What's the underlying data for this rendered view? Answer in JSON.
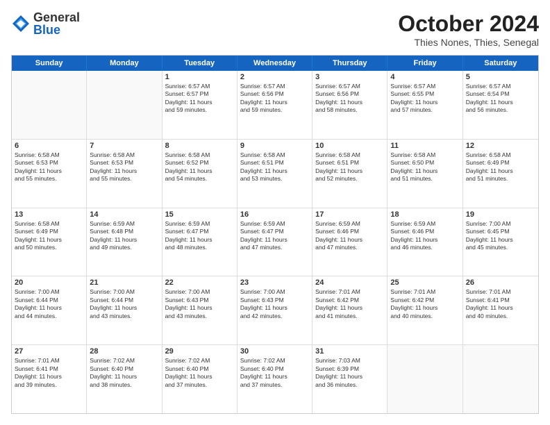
{
  "header": {
    "logo": {
      "general": "General",
      "blue": "Blue"
    },
    "title": "October 2024",
    "subtitle": "Thies Nones, Thies, Senegal"
  },
  "weekdays": [
    "Sunday",
    "Monday",
    "Tuesday",
    "Wednesday",
    "Thursday",
    "Friday",
    "Saturday"
  ],
  "weeks": [
    [
      {
        "day": "",
        "lines": []
      },
      {
        "day": "",
        "lines": []
      },
      {
        "day": "1",
        "lines": [
          "Sunrise: 6:57 AM",
          "Sunset: 6:57 PM",
          "Daylight: 11 hours",
          "and 59 minutes."
        ]
      },
      {
        "day": "2",
        "lines": [
          "Sunrise: 6:57 AM",
          "Sunset: 6:56 PM",
          "Daylight: 11 hours",
          "and 59 minutes."
        ]
      },
      {
        "day": "3",
        "lines": [
          "Sunrise: 6:57 AM",
          "Sunset: 6:56 PM",
          "Daylight: 11 hours",
          "and 58 minutes."
        ]
      },
      {
        "day": "4",
        "lines": [
          "Sunrise: 6:57 AM",
          "Sunset: 6:55 PM",
          "Daylight: 11 hours",
          "and 57 minutes."
        ]
      },
      {
        "day": "5",
        "lines": [
          "Sunrise: 6:57 AM",
          "Sunset: 6:54 PM",
          "Daylight: 11 hours",
          "and 56 minutes."
        ]
      }
    ],
    [
      {
        "day": "6",
        "lines": [
          "Sunrise: 6:58 AM",
          "Sunset: 6:53 PM",
          "Daylight: 11 hours",
          "and 55 minutes."
        ]
      },
      {
        "day": "7",
        "lines": [
          "Sunrise: 6:58 AM",
          "Sunset: 6:53 PM",
          "Daylight: 11 hours",
          "and 55 minutes."
        ]
      },
      {
        "day": "8",
        "lines": [
          "Sunrise: 6:58 AM",
          "Sunset: 6:52 PM",
          "Daylight: 11 hours",
          "and 54 minutes."
        ]
      },
      {
        "day": "9",
        "lines": [
          "Sunrise: 6:58 AM",
          "Sunset: 6:51 PM",
          "Daylight: 11 hours",
          "and 53 minutes."
        ]
      },
      {
        "day": "10",
        "lines": [
          "Sunrise: 6:58 AM",
          "Sunset: 6:51 PM",
          "Daylight: 11 hours",
          "and 52 minutes."
        ]
      },
      {
        "day": "11",
        "lines": [
          "Sunrise: 6:58 AM",
          "Sunset: 6:50 PM",
          "Daylight: 11 hours",
          "and 51 minutes."
        ]
      },
      {
        "day": "12",
        "lines": [
          "Sunrise: 6:58 AM",
          "Sunset: 6:49 PM",
          "Daylight: 11 hours",
          "and 51 minutes."
        ]
      }
    ],
    [
      {
        "day": "13",
        "lines": [
          "Sunrise: 6:58 AM",
          "Sunset: 6:49 PM",
          "Daylight: 11 hours",
          "and 50 minutes."
        ]
      },
      {
        "day": "14",
        "lines": [
          "Sunrise: 6:59 AM",
          "Sunset: 6:48 PM",
          "Daylight: 11 hours",
          "and 49 minutes."
        ]
      },
      {
        "day": "15",
        "lines": [
          "Sunrise: 6:59 AM",
          "Sunset: 6:47 PM",
          "Daylight: 11 hours",
          "and 48 minutes."
        ]
      },
      {
        "day": "16",
        "lines": [
          "Sunrise: 6:59 AM",
          "Sunset: 6:47 PM",
          "Daylight: 11 hours",
          "and 47 minutes."
        ]
      },
      {
        "day": "17",
        "lines": [
          "Sunrise: 6:59 AM",
          "Sunset: 6:46 PM",
          "Daylight: 11 hours",
          "and 47 minutes."
        ]
      },
      {
        "day": "18",
        "lines": [
          "Sunrise: 6:59 AM",
          "Sunset: 6:46 PM",
          "Daylight: 11 hours",
          "and 46 minutes."
        ]
      },
      {
        "day": "19",
        "lines": [
          "Sunrise: 7:00 AM",
          "Sunset: 6:45 PM",
          "Daylight: 11 hours",
          "and 45 minutes."
        ]
      }
    ],
    [
      {
        "day": "20",
        "lines": [
          "Sunrise: 7:00 AM",
          "Sunset: 6:44 PM",
          "Daylight: 11 hours",
          "and 44 minutes."
        ]
      },
      {
        "day": "21",
        "lines": [
          "Sunrise: 7:00 AM",
          "Sunset: 6:44 PM",
          "Daylight: 11 hours",
          "and 43 minutes."
        ]
      },
      {
        "day": "22",
        "lines": [
          "Sunrise: 7:00 AM",
          "Sunset: 6:43 PM",
          "Daylight: 11 hours",
          "and 43 minutes."
        ]
      },
      {
        "day": "23",
        "lines": [
          "Sunrise: 7:00 AM",
          "Sunset: 6:43 PM",
          "Daylight: 11 hours",
          "and 42 minutes."
        ]
      },
      {
        "day": "24",
        "lines": [
          "Sunrise: 7:01 AM",
          "Sunset: 6:42 PM",
          "Daylight: 11 hours",
          "and 41 minutes."
        ]
      },
      {
        "day": "25",
        "lines": [
          "Sunrise: 7:01 AM",
          "Sunset: 6:42 PM",
          "Daylight: 11 hours",
          "and 40 minutes."
        ]
      },
      {
        "day": "26",
        "lines": [
          "Sunrise: 7:01 AM",
          "Sunset: 6:41 PM",
          "Daylight: 11 hours",
          "and 40 minutes."
        ]
      }
    ],
    [
      {
        "day": "27",
        "lines": [
          "Sunrise: 7:01 AM",
          "Sunset: 6:41 PM",
          "Daylight: 11 hours",
          "and 39 minutes."
        ]
      },
      {
        "day": "28",
        "lines": [
          "Sunrise: 7:02 AM",
          "Sunset: 6:40 PM",
          "Daylight: 11 hours",
          "and 38 minutes."
        ]
      },
      {
        "day": "29",
        "lines": [
          "Sunrise: 7:02 AM",
          "Sunset: 6:40 PM",
          "Daylight: 11 hours",
          "and 37 minutes."
        ]
      },
      {
        "day": "30",
        "lines": [
          "Sunrise: 7:02 AM",
          "Sunset: 6:40 PM",
          "Daylight: 11 hours",
          "and 37 minutes."
        ]
      },
      {
        "day": "31",
        "lines": [
          "Sunrise: 7:03 AM",
          "Sunset: 6:39 PM",
          "Daylight: 11 hours",
          "and 36 minutes."
        ]
      },
      {
        "day": "",
        "lines": []
      },
      {
        "day": "",
        "lines": []
      }
    ]
  ]
}
